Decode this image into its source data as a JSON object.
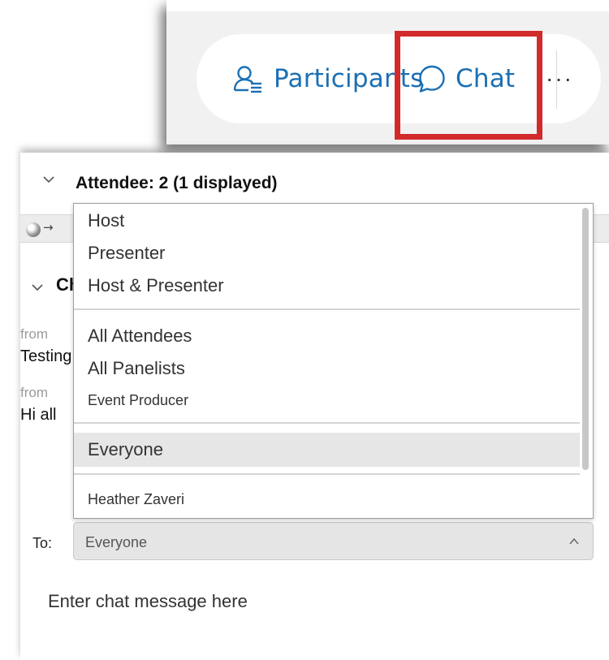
{
  "toolbar": {
    "participants_label": "Participants",
    "chat_label": "Chat",
    "more_label": "···",
    "accent_color": "#1b6fb3",
    "highlight_color": "#d22a2a"
  },
  "attendee": {
    "title": "Attendee: 2 (1 displayed)",
    "status_arrow": "→"
  },
  "chat": {
    "title": "Chat",
    "messages": [
      {
        "from": "from",
        "text": "Testing"
      },
      {
        "from": "from",
        "text": "Hi all"
      }
    ],
    "to_label": "To:",
    "to_value": "Everyone",
    "input_placeholder": "Enter chat message here"
  },
  "dropdown": {
    "options": [
      "Host",
      "Presenter",
      "Host & Presenter",
      "All Attendees",
      "All Panelists",
      "Event Producer",
      "Everyone",
      "Heather Zaveri"
    ],
    "selected": "Everyone"
  }
}
